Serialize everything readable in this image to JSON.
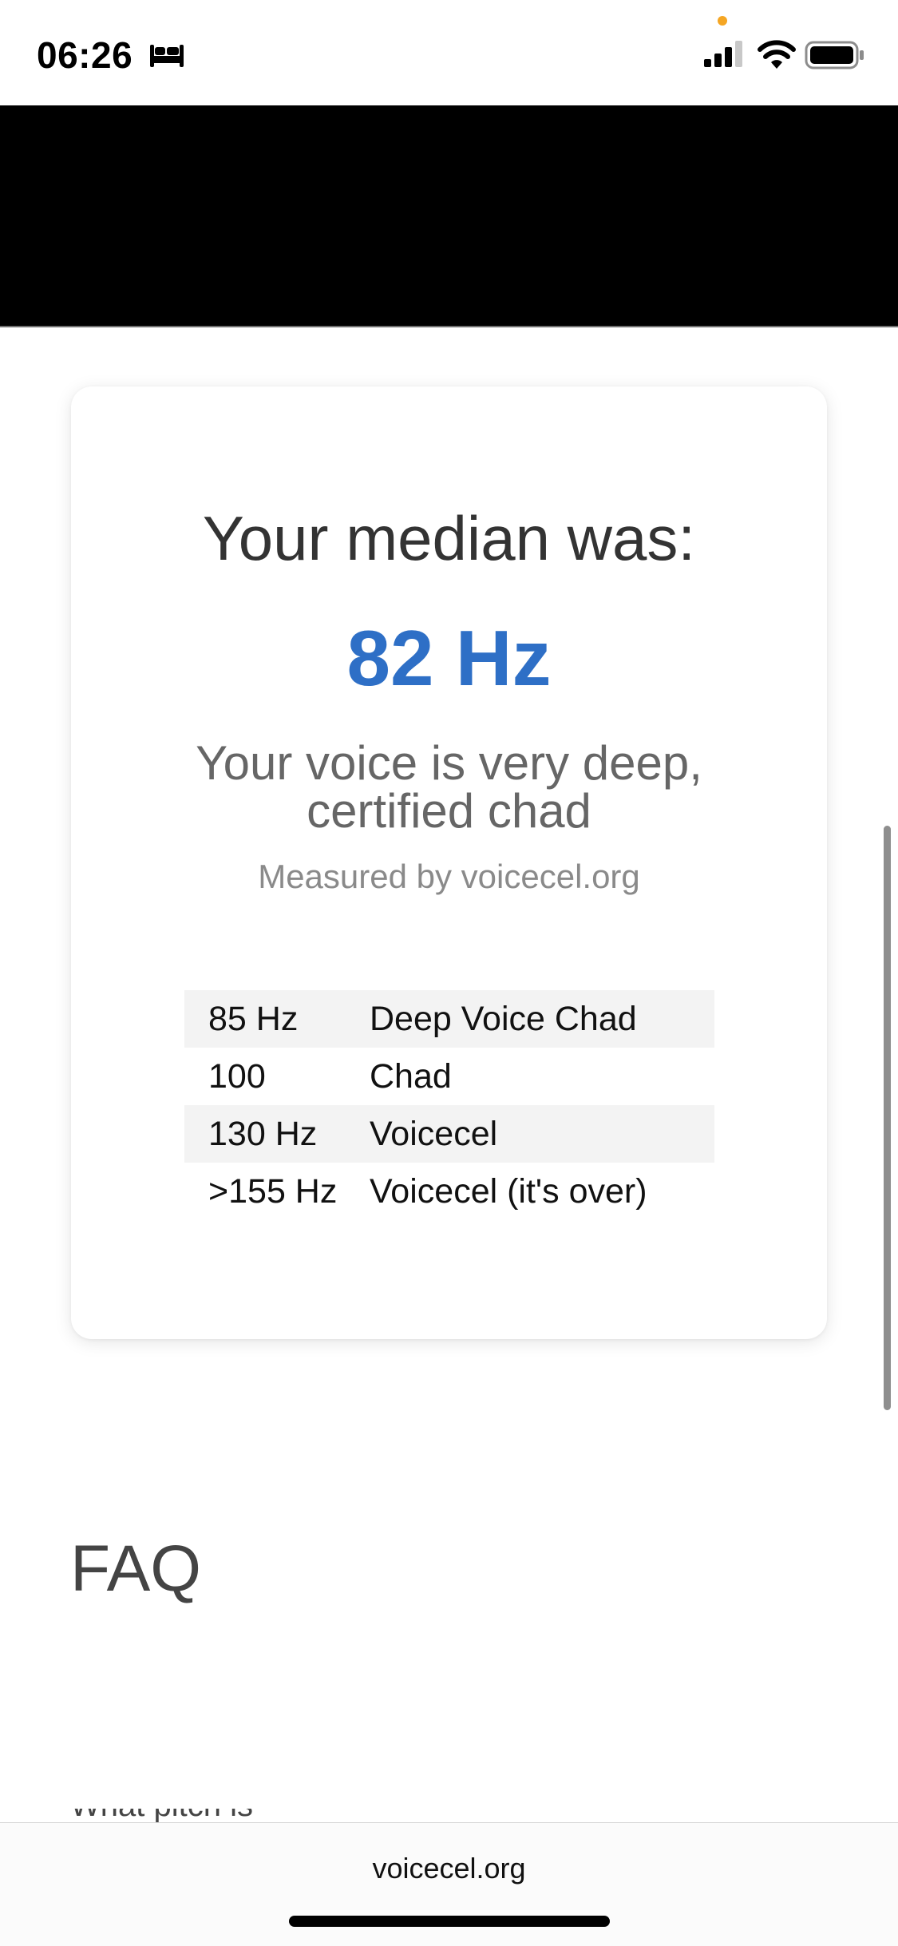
{
  "status_bar": {
    "time": "06:26",
    "sleep_icon": "bed-icon",
    "signal_icon": "cellular-signal-icon",
    "wifi_icon": "wifi-icon",
    "battery_icon": "battery-icon",
    "privacy_dot_color": "#f5a623"
  },
  "result": {
    "heading": "Your median was:",
    "value": "82 Hz",
    "verdict_line1": "Your voice is very deep,",
    "verdict_line2": "certified chad",
    "measured_by": "Measured by voicecel.org",
    "accent_color": "#2e6fc6"
  },
  "reference_table": [
    {
      "freq": "85 Hz",
      "label": "Deep Voice Chad"
    },
    {
      "freq": "100",
      "label": "Chad"
    },
    {
      "freq": "130 Hz",
      "label": "Voicecel"
    },
    {
      "freq": ">155 Hz",
      "label": "Voicecel (it's over)"
    }
  ],
  "faq": {
    "heading": "FAQ",
    "first_question_partial": "What pitch is"
  },
  "browser": {
    "address": "voicecel.org"
  }
}
